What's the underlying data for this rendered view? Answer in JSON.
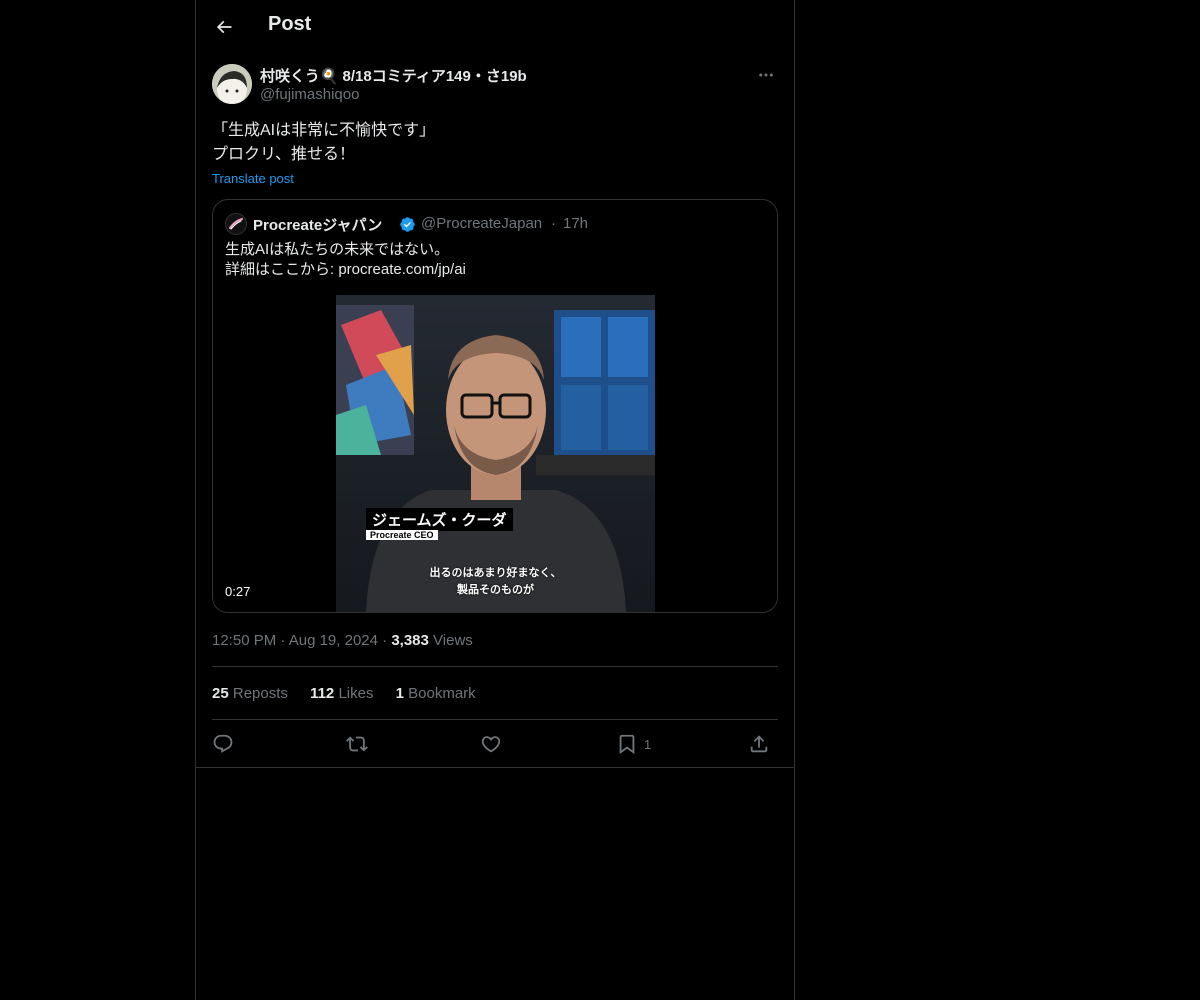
{
  "header": {
    "title": "Post"
  },
  "post": {
    "author_name": "村咲くう🍳 8/18コミティア149・さ19b",
    "author_handle": "@fujimashiqoo",
    "text_lines": [
      "「生成AIは非常に不愉快です」",
      "プロクリ、推せる！"
    ],
    "translate_label": "Translate post",
    "quote": {
      "name": "Procreateジャパン",
      "handle": "@ProcreateJapan",
      "separator": "·",
      "time": "17h",
      "text_lines": [
        "生成AIは私たちの未来ではない。",
        "詳細はここから: procreate.com/jp/ai"
      ],
      "video": {
        "duration": "0:27",
        "name_plate": "ジェームズ・クーダ",
        "name_sub": "Procreate CEO",
        "subtitle_lines": [
          "出るのはあまり好まなく、",
          "製品そのものが"
        ]
      }
    },
    "meta": {
      "time": "12:50 PM",
      "dot1": "·",
      "date": "Aug 19, 2024",
      "dot2": "·",
      "views_count": "3,383",
      "views_label": "Views"
    },
    "stats": {
      "reposts_count": "25",
      "reposts_label": "Reposts",
      "likes_count": "112",
      "likes_label": "Likes",
      "bookmarks_count": "1",
      "bookmarks_label": "Bookmark"
    },
    "actions": {
      "bookmark_count": "1"
    }
  },
  "colors": {
    "background": "#000000",
    "text": "#e7e9ea",
    "muted": "#71767b",
    "link": "#1d9bf0",
    "border": "#2f3336",
    "verified": "#1d9bf0"
  },
  "icons": [
    "back-arrow-icon",
    "more-icon",
    "verified-icon",
    "reply-icon",
    "repost-icon",
    "like-icon",
    "bookmark-icon",
    "share-icon"
  ]
}
